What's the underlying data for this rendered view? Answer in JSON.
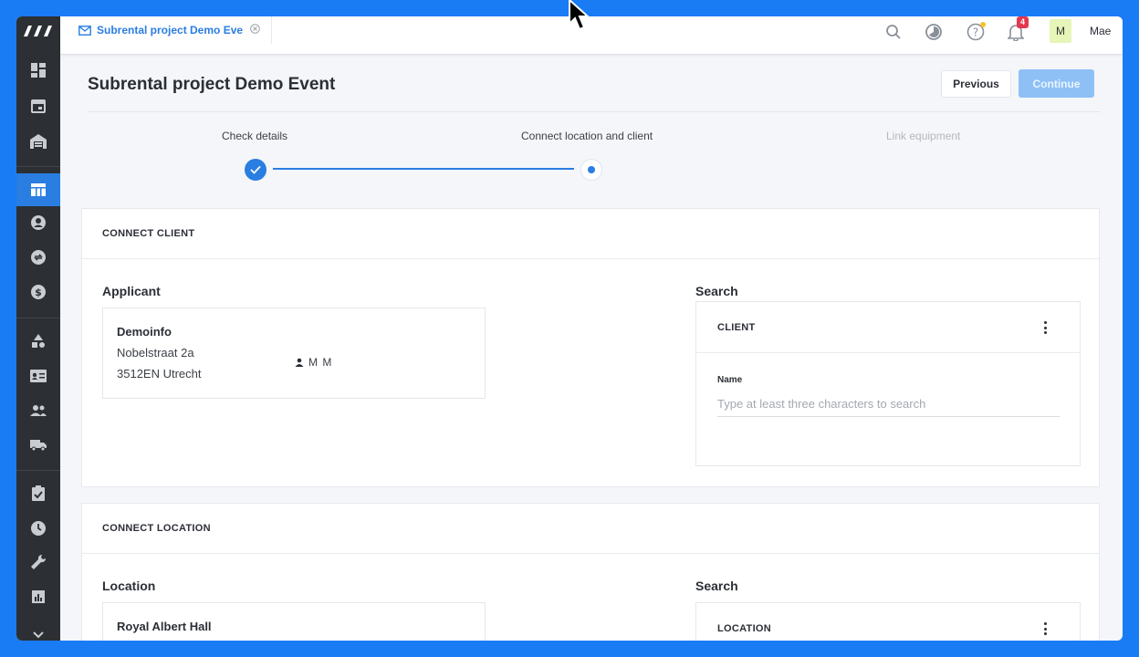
{
  "tab": {
    "title": "Subrental project Demo Event",
    "icon": "envelope-icon"
  },
  "topbar": {
    "notifications_count": "4",
    "avatar_initial": "M",
    "user_name": "Mae"
  },
  "page": {
    "title": "Subrental project Demo Event",
    "previous_label": "Previous",
    "continue_label": "Continue"
  },
  "stepper": {
    "steps": [
      {
        "label": "Check details",
        "state": "done"
      },
      {
        "label": "Connect location and client",
        "state": "current"
      },
      {
        "label": "Link equipment",
        "state": "upcoming"
      }
    ]
  },
  "client_section": {
    "heading": "CONNECT CLIENT",
    "applicant_label": "Applicant",
    "applicant": {
      "name": "Demoinfo",
      "street": "Nobelstraat 2a",
      "city": "3512EN Utrecht",
      "contact": "M M"
    },
    "search_label": "Search",
    "search_header": "CLIENT",
    "field_label": "Name",
    "placeholder": "Type at least three characters to search"
  },
  "location_section": {
    "heading": "CONNECT LOCATION",
    "location_label": "Location",
    "location": {
      "name": "Royal Albert Hall"
    },
    "search_label": "Search",
    "search_header": "LOCATION"
  },
  "sidebar": {
    "items": [
      {
        "icon": "dashboard-icon"
      },
      {
        "icon": "calendar-icon"
      },
      {
        "icon": "warehouse-icon"
      },
      {
        "icon": "projects-table-icon",
        "active": true
      },
      {
        "icon": "contact-icon"
      },
      {
        "icon": "exchange-icon"
      },
      {
        "icon": "dollar-icon"
      },
      {
        "icon": "shapes-icon"
      },
      {
        "icon": "id-card-icon"
      },
      {
        "icon": "people-icon"
      },
      {
        "icon": "truck-icon"
      },
      {
        "icon": "clipboard-check-icon"
      },
      {
        "icon": "clock-icon"
      },
      {
        "icon": "wrench-icon"
      },
      {
        "icon": "bar-chart-icon"
      },
      {
        "icon": "chevron-down-icon"
      }
    ]
  },
  "colors": {
    "brand_blue": "#1a7cf5",
    "accent": "#2a7de1",
    "sidebar_bg": "#2c2f33",
    "continue_disabled": "#8ec0f6"
  }
}
